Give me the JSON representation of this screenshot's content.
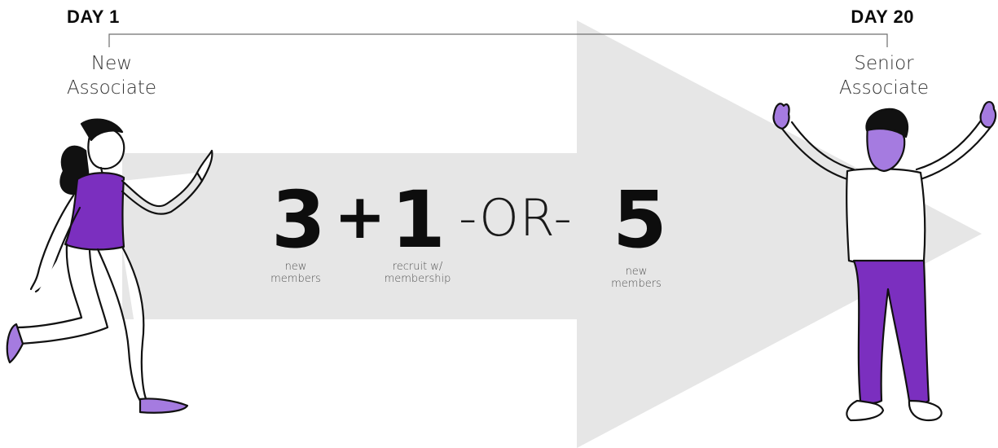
{
  "timeline": {
    "start_day": "DAY 1",
    "end_day": "DAY 20",
    "start_role_line1": "New",
    "start_role_line2": "Associate",
    "end_role_line1": "Senior",
    "end_role_line2": "Associate"
  },
  "formula": {
    "first_number": "3",
    "first_caption_line1": "new",
    "first_caption_line2": "members",
    "plus": "+",
    "second_number": "1",
    "second_caption_line1": "recruit w/",
    "second_caption_line2": "membership",
    "or_text": "-OR-",
    "third_number": "5",
    "third_caption_line1": "new",
    "third_caption_line2": "members"
  },
  "colors": {
    "arrow": "#e6e6e6",
    "accent_purple": "#7b2fbf",
    "accent_lavender": "#a57be0",
    "ink": "#111111"
  }
}
